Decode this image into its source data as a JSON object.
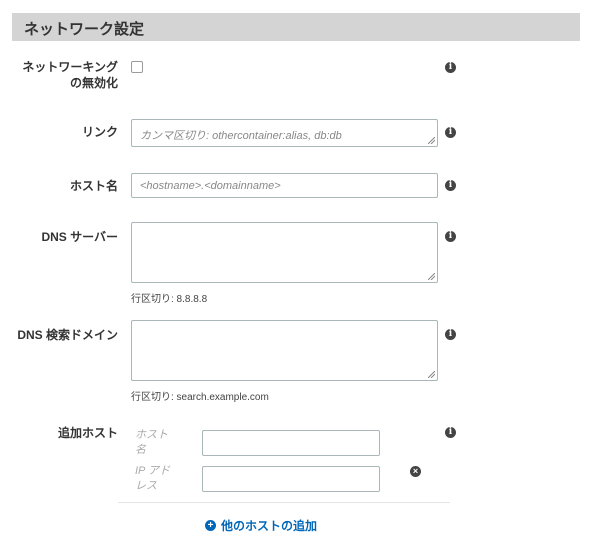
{
  "section": {
    "title": "ネットワーク設定"
  },
  "fields": {
    "disable_networking": {
      "label_line1": "ネットワーキング",
      "label_line2": "の無効化",
      "checked": false
    },
    "links": {
      "label": "リンク",
      "placeholder": "カンマ区切り: othercontainer:alias, db:db"
    },
    "hostname": {
      "label": "ホスト名",
      "placeholder": "<hostname>.<domainname>"
    },
    "dns_servers": {
      "label": "DNS サーバー",
      "hint": "行区切り: 8.8.8.8"
    },
    "dns_search": {
      "label": "DNS 検索ドメイン",
      "hint": "行区切り: search.example.com"
    },
    "extra_hosts": {
      "label": "追加ホスト",
      "hostname_label_line1": "ホスト",
      "hostname_label_line2": "名",
      "ip_label_line1": "IP アド",
      "ip_label_line2": "レス",
      "add_label": "他のホストの追加"
    }
  },
  "icons": {
    "info": "info-icon",
    "remove": "remove-icon",
    "add": "plus-circle-icon"
  },
  "colors": {
    "header_bg": "#d4d4d4",
    "link": "#0066b8"
  }
}
